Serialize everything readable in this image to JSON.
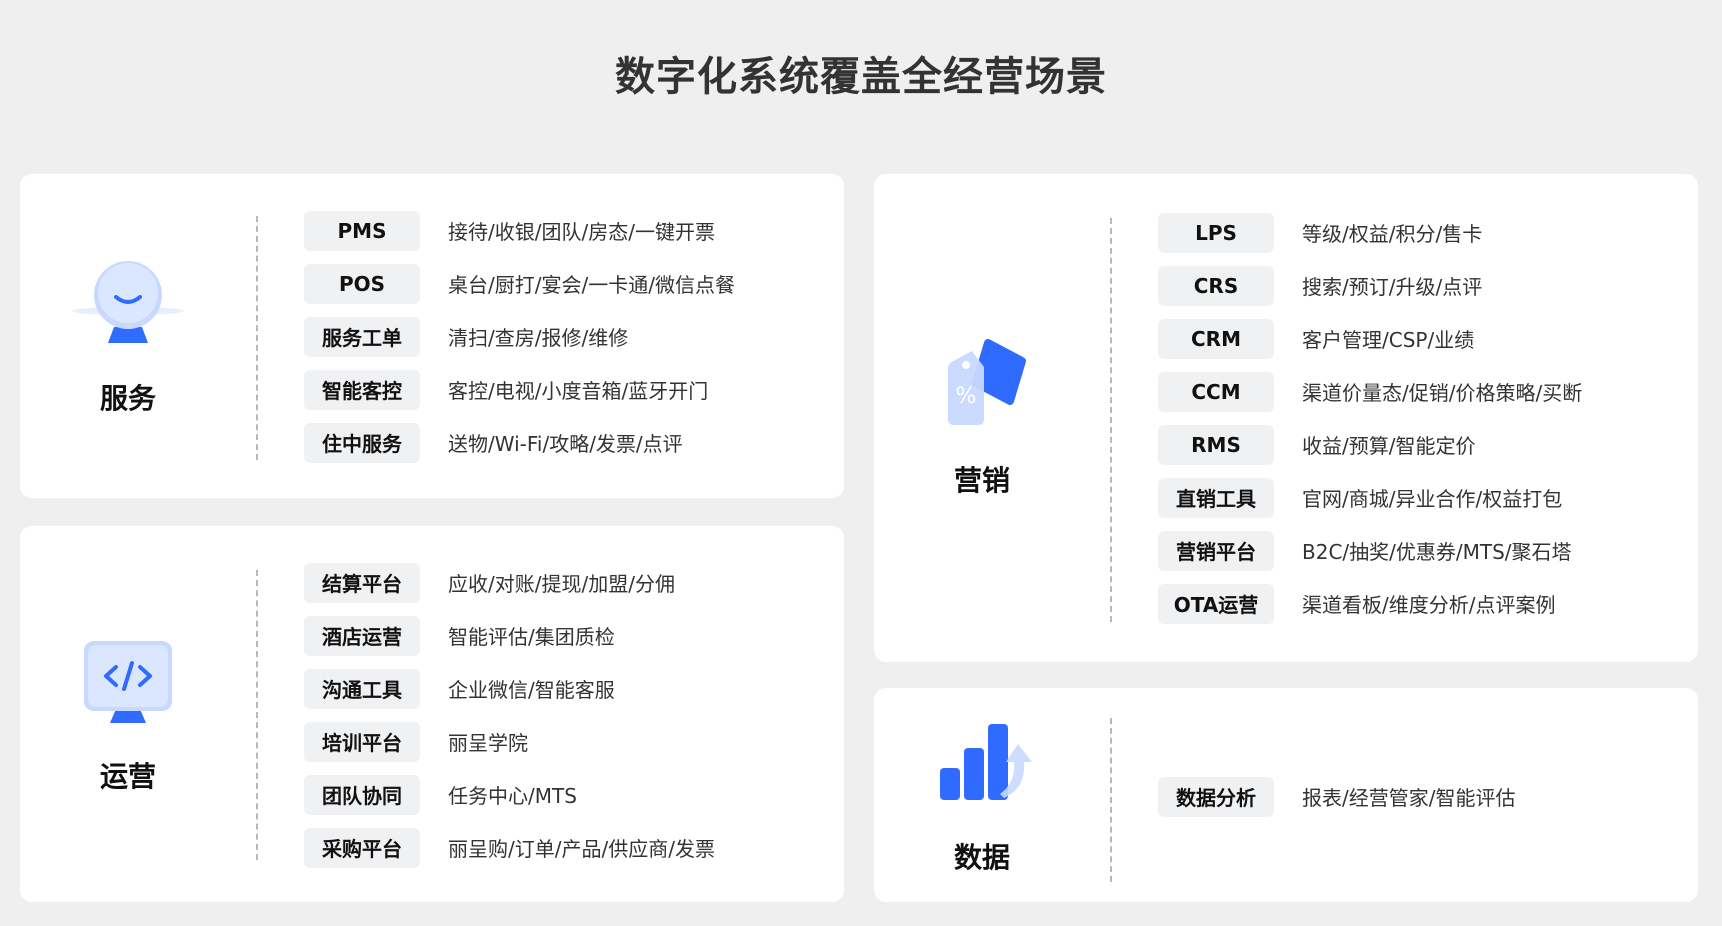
{
  "title": "数字化系统覆盖全经营场景",
  "cards": {
    "service": {
      "name": "服务",
      "rows": [
        {
          "tag": "PMS",
          "desc": "接待/收银/团队/房态/一键开票"
        },
        {
          "tag": "POS",
          "desc": "桌台/厨打/宴会/一卡通/微信点餐"
        },
        {
          "tag": "服务工单",
          "desc": "清扫/查房/报修/维修"
        },
        {
          "tag": "智能客控",
          "desc": "客控/电视/小度音箱/蓝牙开门"
        },
        {
          "tag": "住中服务",
          "desc": "送物/Wi-Fi/攻略/发票/点评"
        }
      ]
    },
    "operations": {
      "name": "运营",
      "rows": [
        {
          "tag": "结算平台",
          "desc": "应收/对账/提现/加盟/分佣"
        },
        {
          "tag": "酒店运营",
          "desc": "智能评估/集团质检"
        },
        {
          "tag": "沟通工具",
          "desc": "企业微信/智能客服"
        },
        {
          "tag": "培训平台",
          "desc": "丽呈学院"
        },
        {
          "tag": "团队协同",
          "desc": "任务中心/MTS"
        },
        {
          "tag": "采购平台",
          "desc": "丽呈购/订单/产品/供应商/发票"
        }
      ]
    },
    "marketing": {
      "name": "营销",
      "rows": [
        {
          "tag": "LPS",
          "desc": "等级/权益/积分/售卡"
        },
        {
          "tag": "CRS",
          "desc": "搜索/预订/升级/点评"
        },
        {
          "tag": "CRM",
          "desc": "客户管理/CSP/业绩"
        },
        {
          "tag": "CCM",
          "desc": "渠道价量态/促销/价格策略/买断"
        },
        {
          "tag": "RMS",
          "desc": "收益/预算/智能定价"
        },
        {
          "tag": "直销工具",
          "desc": "官网/商城/异业合作/权益打包"
        },
        {
          "tag": "营销平台",
          "desc": "B2C/抽奖/优惠券/MTS/聚石塔"
        },
        {
          "tag": "OTA运营",
          "desc": "渠道看板/维度分析/点评案例"
        }
      ]
    },
    "data": {
      "name": "数据",
      "rows": [
        {
          "tag": "数据分析",
          "desc": "报表/经营管家/智能评估"
        }
      ]
    }
  },
  "icons": {
    "service": "robot-face-icon",
    "operations": "code-monitor-icon",
    "marketing": "price-tag-icon",
    "data": "bar-chart-icon"
  },
  "colors": {
    "accent": "#2f6bff",
    "background": "#efefef",
    "card": "#ffffff",
    "tag": "#f0f1f3"
  }
}
